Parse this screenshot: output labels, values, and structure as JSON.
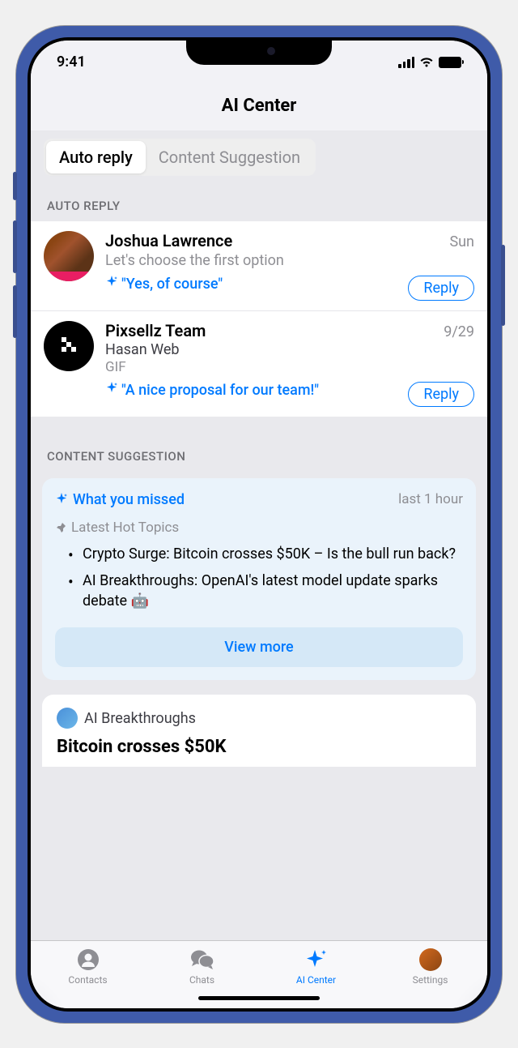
{
  "status": {
    "time": "9:41"
  },
  "header": {
    "title": "AI Center"
  },
  "segments": {
    "autoReply": "Auto reply",
    "contentSuggestion": "Content Suggestion"
  },
  "sections": {
    "autoReply": "AUTO REPLY",
    "contentSuggestion": "CONTENT SUGGESTION"
  },
  "replies": [
    {
      "name": "Joshua Lawrence",
      "date": "Sun",
      "message": "Let's choose the first option",
      "suggestion": "\"Yes, of course\"",
      "button": "Reply"
    },
    {
      "name": "Pixsellz Team",
      "date": "9/29",
      "sub": "Hasan Web",
      "gif": "GIF",
      "suggestion": "\"A nice proposal for our team!\"",
      "button": "Reply"
    }
  ],
  "suggestionCard": {
    "title": "What you missed",
    "time": "last 1 hour",
    "subtitle": "Latest Hot Topics",
    "topics": [
      "Crypto Surge: Bitcoin crosses $50K – Is the bull run back?",
      "AI Breakthroughs: OpenAI's latest model update sparks debate 🤖"
    ],
    "viewMore": "View more"
  },
  "article": {
    "source": "AI Breakthroughs",
    "title": "Bitcoin crosses $50K"
  },
  "tabs": {
    "contacts": "Contacts",
    "chats": "Chats",
    "aiCenter": "AI Center",
    "settings": "Settings"
  }
}
